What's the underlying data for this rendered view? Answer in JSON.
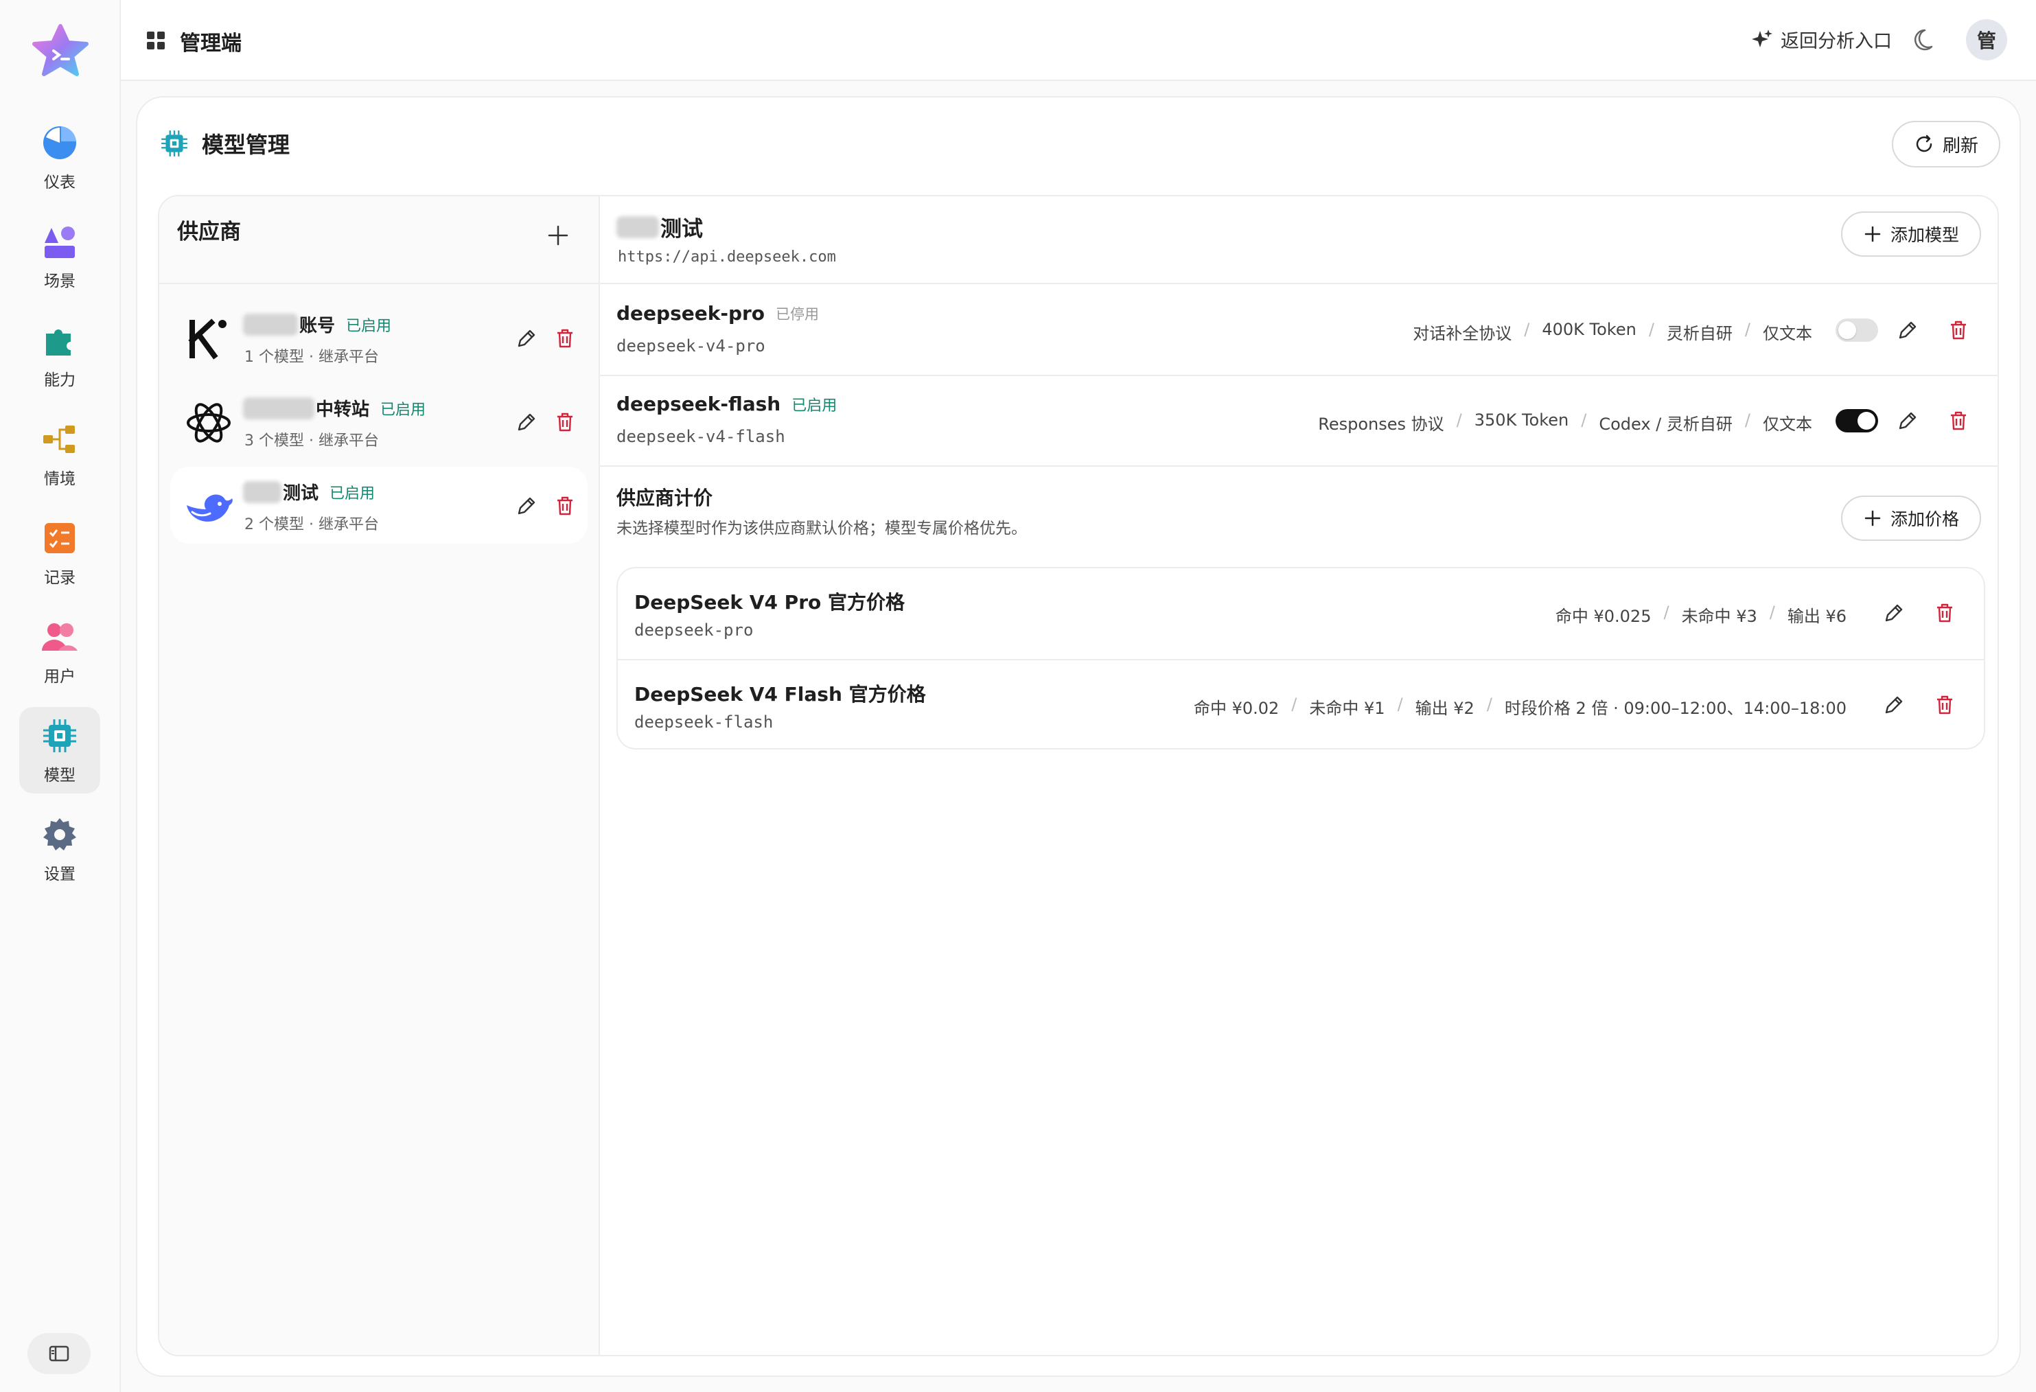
{
  "topbar": {
    "title": "管理端",
    "back_label": "返回分析入口",
    "avatar_text": "管"
  },
  "sidebar": {
    "items": [
      {
        "label": "仪表",
        "icon": "pie-chart-icon",
        "color": "#3b8df0"
      },
      {
        "label": "场景",
        "icon": "shapes-icon",
        "color": "#7c5cf0"
      },
      {
        "label": "能力",
        "icon": "puzzle-icon",
        "color": "#1e9a8a"
      },
      {
        "label": "情境",
        "icon": "flow-icon",
        "color": "#d19a1e"
      },
      {
        "label": "记录",
        "icon": "checklist-icon",
        "color": "#f07a2a"
      },
      {
        "label": "用户",
        "icon": "users-icon",
        "color": "#ef5a8a"
      },
      {
        "label": "模型",
        "icon": "chip-icon",
        "color": "#1ea3b8"
      },
      {
        "label": "设置",
        "icon": "gear-icon",
        "color": "#5b6b85"
      }
    ],
    "active": "模型"
  },
  "page": {
    "title": "模型管理",
    "refresh_label": "刷新"
  },
  "providers": {
    "heading": "供应商",
    "items": [
      {
        "name": "账号",
        "status": "已启用",
        "sub": "1 个模型 · 继承平台",
        "logo": "k-logo-icon"
      },
      {
        "name": "中转站",
        "status": "已启用",
        "sub": "3 个模型 · 继承平台",
        "logo": "openai-logo-icon"
      },
      {
        "name": "测试",
        "status": "已启用",
        "sub": "2 个模型 · 继承平台",
        "logo": "deepseek-logo-icon"
      }
    ]
  },
  "detail": {
    "title": "测试",
    "url": "https://api.deepseek.com",
    "add_model_label": "添加模型",
    "models": [
      {
        "name": "deepseek-pro",
        "status": "已停用",
        "id": "deepseek-v4-pro",
        "tags": [
          "对话补全协议",
          "400K Token",
          "灵析自研",
          "仅文本"
        ],
        "enabled": false
      },
      {
        "name": "deepseek-flash",
        "status": "已启用",
        "id": "deepseek-v4-flash",
        "tags": [
          "Responses 协议",
          "350K Token",
          "Codex / 灵析自研",
          "仅文本"
        ],
        "enabled": true
      }
    ],
    "pricing": {
      "title": "供应商计价",
      "desc": "未选择模型时作为该供应商默认价格；模型专属价格优先。",
      "add_label": "添加价格",
      "rows": [
        {
          "name": "DeepSeek V4 Pro 官方价格",
          "id": "deepseek-pro",
          "tags": [
            "命中 ¥0.025",
            "未命中 ¥3",
            "输出 ¥6"
          ]
        },
        {
          "name": "DeepSeek V4 Flash 官方价格",
          "id": "deepseek-flash",
          "tags": [
            "命中 ¥0.02",
            "未命中 ¥1",
            "输出 ¥2",
            "时段价格 2 倍 · 09:00–12:00、14:00–18:00"
          ]
        }
      ]
    }
  },
  "colors": {
    "accent_green": "#14876f",
    "danger": "#d0243a"
  }
}
